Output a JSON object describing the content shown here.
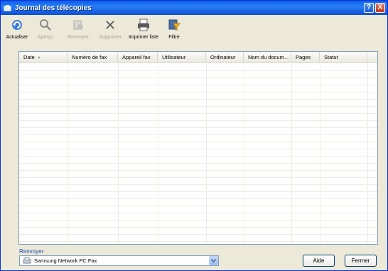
{
  "window": {
    "title": "Journal des télécopies"
  },
  "toolbar": {
    "refresh": "Actualiser",
    "preview": "Aperçu",
    "resend": "Renvoyer",
    "delete": "Supprimer",
    "print_list": "Imprimer liste",
    "filter": "Filtre"
  },
  "columns": {
    "date": "Date",
    "fax_number": "Numéro de fax",
    "fax_device": "Appareil fax",
    "user": "Utilisateur",
    "computer": "Ordinateur",
    "doc_name": "Nom du docum...",
    "pages": "Pages",
    "status": "Statut"
  },
  "resend_section": {
    "label": "Renvoyer",
    "selected_fax": "Samsung Network PC Fax"
  },
  "buttons": {
    "help": "Aide",
    "close": "Fermer"
  },
  "title_buttons": {
    "help": "?",
    "close": "X"
  }
}
